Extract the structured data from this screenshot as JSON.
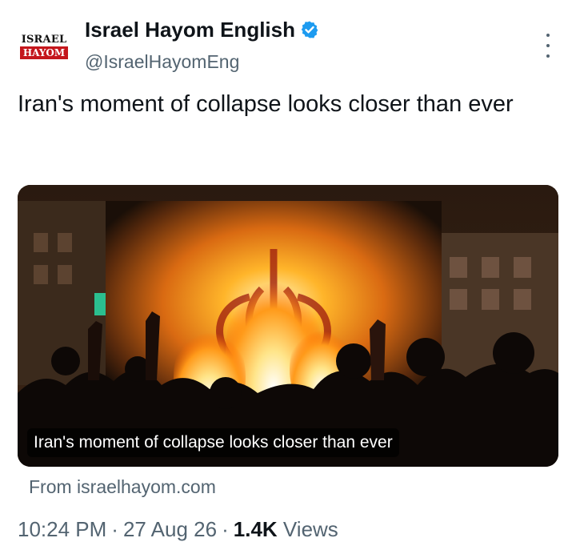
{
  "author": {
    "display_name": "Israel Hayom English",
    "handle": "@IsraelHayomEng",
    "avatar_top": "ISRAEL",
    "avatar_bottom": "HAYOM",
    "verified_color": "#1d9bf0"
  },
  "tweet": {
    "text": "Iran's moment of collapse looks closer than ever"
  },
  "card": {
    "caption": "Iran's moment of collapse looks closer than ever",
    "source": "From israelhayom.com"
  },
  "meta": {
    "time": "10:24 PM",
    "date": "27 Aug 26",
    "views_count": "1.4K",
    "views_label": "Views",
    "separator": "·"
  },
  "colors": {
    "text_primary": "#0f1419",
    "text_secondary": "#536471",
    "brand_red": "#c4161c"
  }
}
